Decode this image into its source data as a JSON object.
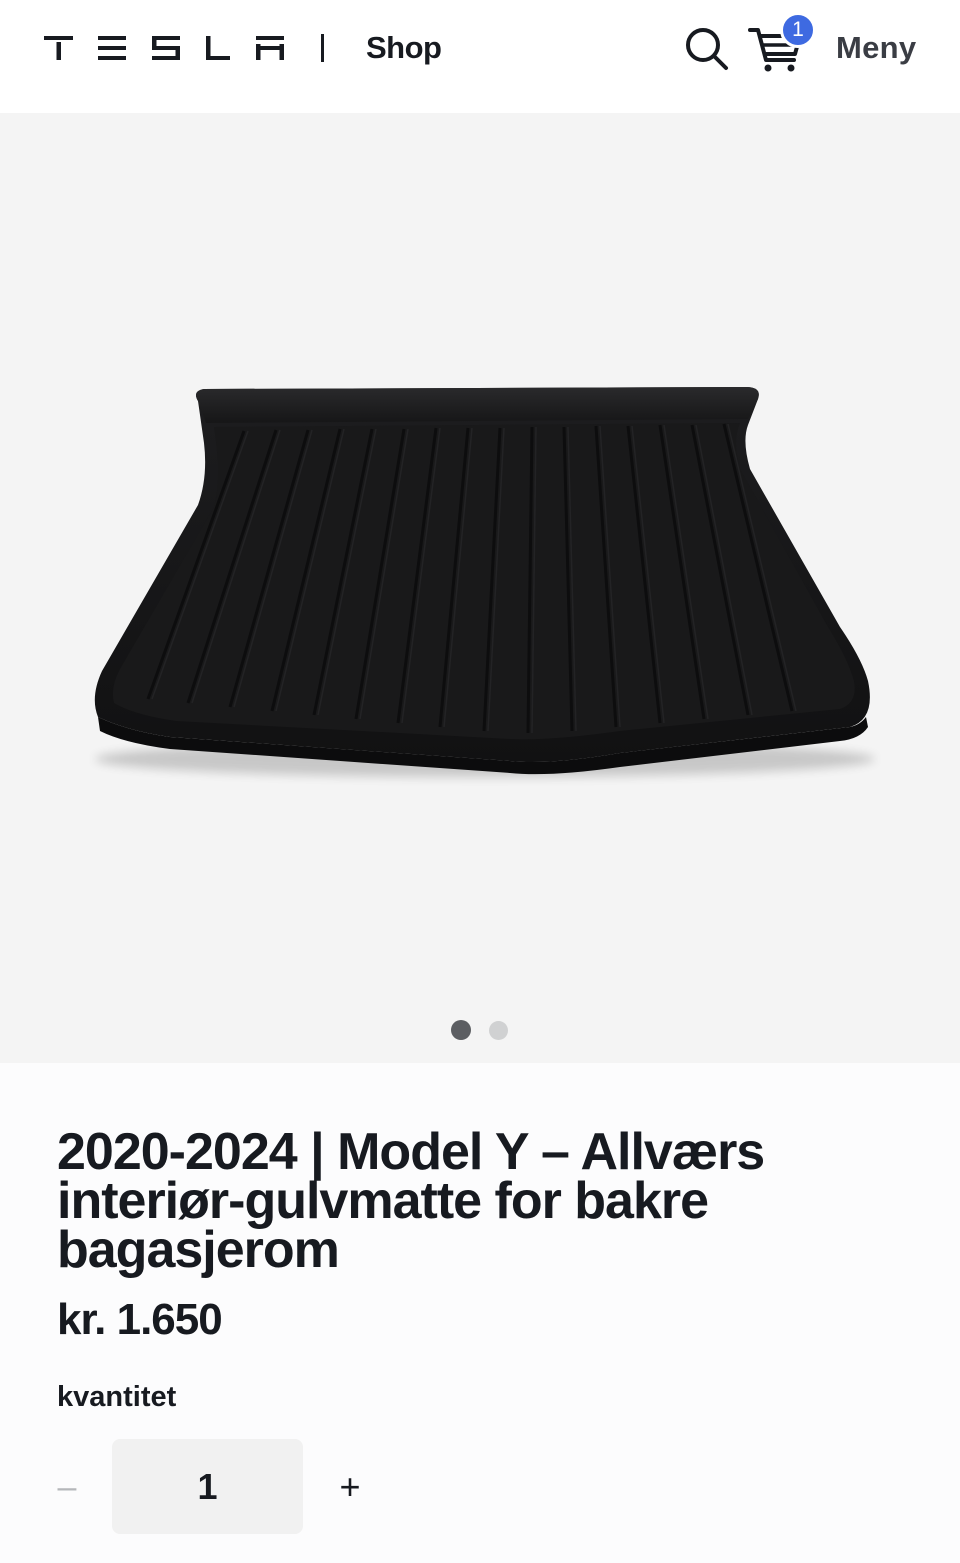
{
  "header": {
    "logo_text": "TESLA",
    "shop_label": "Shop",
    "cart_count": "1",
    "menu_label": "Meny",
    "icons": {
      "search": "search-icon",
      "cart": "cart-icon"
    }
  },
  "gallery": {
    "image_subject": "all-weather rear trunk mat",
    "slide_count": 2,
    "active_slide": 1
  },
  "product": {
    "title": "2020-2024 | Model Y – Allværs interiør-gulvmatte for bakre bagasjerom",
    "price": "kr. 1.650"
  },
  "quantity": {
    "label": "kvantitet",
    "value": "1",
    "decrement_symbol": "–",
    "increment_symbol": "+"
  },
  "colors": {
    "text": "#171a20",
    "cart_badge": "#3e6ae1",
    "gallery_bg": "#f4f4f4",
    "active_dot": "#5c5e62",
    "inactive_dot": "#d0d1d2",
    "input_bg": "#f1f1f1"
  }
}
